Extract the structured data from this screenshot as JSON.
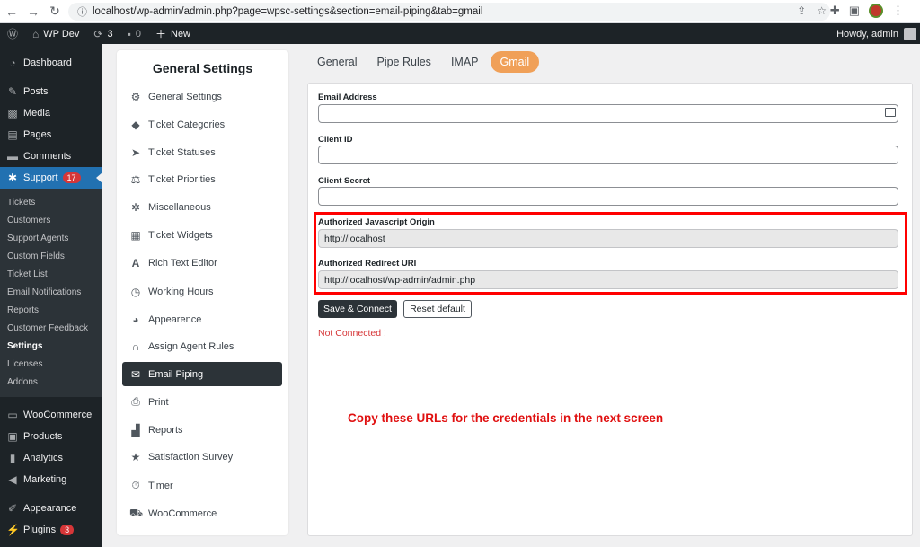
{
  "browser": {
    "url": "localhost/wp-admin/admin.php?page=wpsc-settings&section=email-piping&tab=gmail"
  },
  "adminbar": {
    "site_name": "WP Dev",
    "updates_count": "3",
    "comments_count": "0",
    "new_label": "New",
    "greeting": "Howdy, admin"
  },
  "sidebar": {
    "top_items": [
      {
        "label": "Dashboard",
        "icon": "dashboard-icon"
      },
      {
        "label": "Posts",
        "icon": "pin-icon"
      },
      {
        "label": "Media",
        "icon": "media-icon"
      },
      {
        "label": "Pages",
        "icon": "pages-icon"
      },
      {
        "label": "Comments",
        "icon": "comment-icon"
      },
      {
        "label": "Support",
        "icon": "support-icon",
        "badge": "17"
      }
    ],
    "submenu": [
      "Tickets",
      "Customers",
      "Support Agents",
      "Custom Fields",
      "Ticket List",
      "Email Notifications",
      "Reports",
      "Customer Feedback",
      "Settings",
      "Licenses",
      "Addons"
    ],
    "current_submenu": "Settings",
    "bottom_items": [
      {
        "label": "WooCommerce",
        "icon": "woo-icon"
      },
      {
        "label": "Products",
        "icon": "products-icon"
      },
      {
        "label": "Analytics",
        "icon": "analytics-icon"
      },
      {
        "label": "Marketing",
        "icon": "megaphone-icon"
      },
      {
        "label": "Appearance",
        "icon": "brush-icon"
      },
      {
        "label": "Plugins",
        "icon": "plugin-icon",
        "badge": "3"
      }
    ]
  },
  "settings_nav": {
    "title": "General Settings",
    "items": [
      {
        "label": "General Settings",
        "icon": "gear-icon"
      },
      {
        "label": "Ticket Categories",
        "icon": "tag-icon"
      },
      {
        "label": "Ticket Statuses",
        "icon": "send-icon"
      },
      {
        "label": "Ticket Priorities",
        "icon": "balance-icon"
      },
      {
        "label": "Miscellaneous",
        "icon": "gears-icon"
      },
      {
        "label": "Ticket Widgets",
        "icon": "grid-icon"
      },
      {
        "label": "Rich Text Editor",
        "icon": "font-icon"
      },
      {
        "label": "Working Hours",
        "icon": "clock-icon"
      },
      {
        "label": "Appearence",
        "icon": "palette-icon"
      },
      {
        "label": "Assign Agent Rules",
        "icon": "headset-icon"
      },
      {
        "label": "Email Piping",
        "icon": "envelope-icon",
        "active": true
      },
      {
        "label": "Print",
        "icon": "printer-icon"
      },
      {
        "label": "Reports",
        "icon": "chart-icon"
      },
      {
        "label": "Satisfaction Survey",
        "icon": "star-icon"
      },
      {
        "label": "Timer",
        "icon": "stopwatch-icon"
      },
      {
        "label": "WooCommerce",
        "icon": "cart-icon"
      }
    ]
  },
  "tabs": [
    "General",
    "Pipe Rules",
    "IMAP",
    "Gmail"
  ],
  "active_tab": "Gmail",
  "form": {
    "email_label": "Email Address",
    "email_value": "",
    "client_id_label": "Client ID",
    "client_id_value": "",
    "client_secret_label": "Client Secret",
    "client_secret_value": "",
    "js_origin_label": "Authorized Javascript Origin",
    "js_origin_value": "http://localhost",
    "redirect_label": "Authorized Redirect URI",
    "redirect_value": "http://localhost/wp-admin/admin.php",
    "save_button": "Save & Connect",
    "reset_button": "Reset default",
    "status": "Not Connected !"
  },
  "annotation": "Copy these URLs for the credentials in the next screen",
  "colors": {
    "accent_tab": "#f0a058",
    "highlight": "#ff0000",
    "wp_blue": "#2271b1",
    "status_red": "#d63638"
  }
}
